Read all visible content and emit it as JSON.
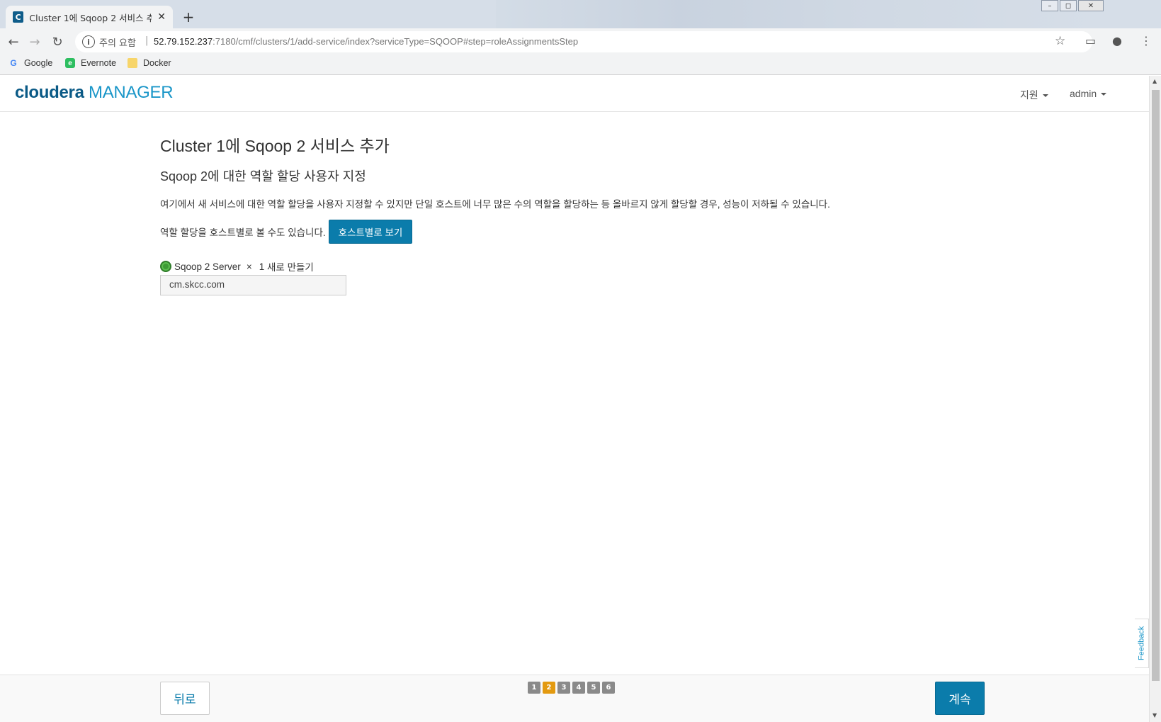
{
  "browser": {
    "tab_title": "Cluster 1에 Sqoop 2 서비스 추가",
    "favicon_letter": "C",
    "tab_close": "✕",
    "new_tab": "+",
    "security_text": "주의 요함",
    "url_host": "52.79.152.237",
    "url_rest": ":7180/cmf/clusters/1/add-service/index?serviceType=SQOOP#step=roleAssignmentsStep",
    "bookmarks": [
      {
        "label": "Google",
        "icon": "google-icon"
      },
      {
        "label": "Evernote",
        "icon": "evernote-icon"
      },
      {
        "label": "Docker",
        "icon": "folder-icon"
      }
    ]
  },
  "header": {
    "logo_bold": "cloudera",
    "logo_light": "MANAGER",
    "support_menu": "지원",
    "user_menu": "admin"
  },
  "main": {
    "title": "Cluster 1에 Sqoop 2 서비스 추가",
    "subtitle": "Sqoop 2에 대한 역할 할당 사용자 지정",
    "description": "여기에서 새 서비스에 대한 역할 할당을 사용자 지정할 수 있지만 단일 호스트에 너무 많은 수의 역할을 할당하는 등 올바르지 않게 할당할 경우, 성능이 저하될 수 있습니다.",
    "host_view_text": "역할 할당을 호스트별로 볼 수도 있습니다.",
    "host_view_button": "호스트별로 보기",
    "role": {
      "name": "Sqoop 2 Server",
      "times": "×",
      "count": "1",
      "suffix": "새로 만들기",
      "host": "cm.skcc.com",
      "status_color": "#3d9b35"
    }
  },
  "footer": {
    "back_label": "뒤로",
    "next_label": "계속",
    "steps": [
      "1",
      "2",
      "3",
      "4",
      "5",
      "6"
    ],
    "active_step": "2"
  },
  "feedback_label": "Feedback",
  "colors": {
    "primary": "#0b7cab",
    "active_step": "#e39a10"
  }
}
